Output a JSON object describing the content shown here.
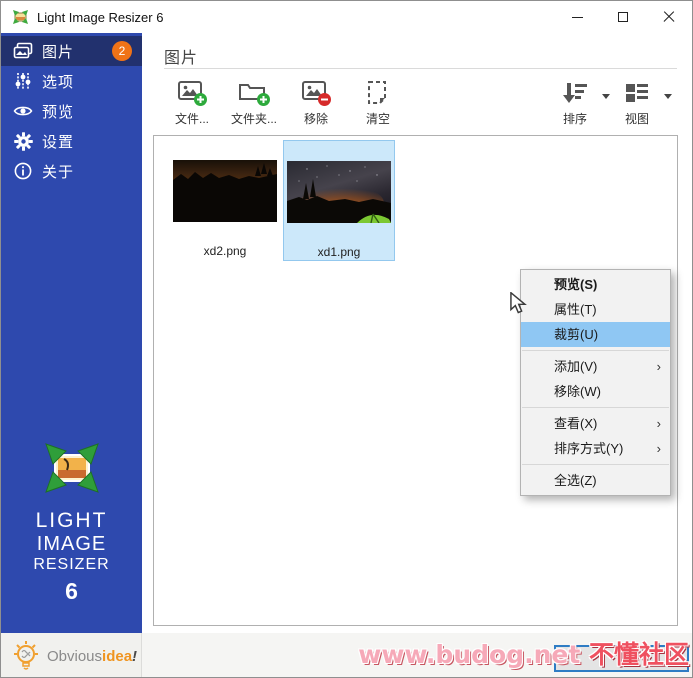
{
  "window": {
    "title": "Light Image Resizer 6"
  },
  "sidebar": {
    "items": [
      {
        "label": "图片",
        "icon": "photos-icon",
        "badge": "2",
        "selected": true
      },
      {
        "label": "选项",
        "icon": "sliders-icon",
        "selected": false
      },
      {
        "label": "预览",
        "icon": "eye-icon",
        "selected": false
      },
      {
        "label": "设置",
        "icon": "gear-icon",
        "selected": false
      },
      {
        "label": "关于",
        "icon": "info-icon",
        "selected": false
      }
    ],
    "logo": {
      "line1": "LIGHT",
      "line2": "IMAGE",
      "line3": "RESIZER",
      "version": "6"
    },
    "brand": {
      "prefix": "Obvious",
      "highlight": "idea",
      "suffix": "!"
    }
  },
  "main": {
    "page_title": "图片",
    "toolbar": {
      "add_files": "文件...",
      "add_folder": "文件夹...",
      "remove": "移除",
      "clear": "清空",
      "sort": "排序",
      "view": "视图"
    },
    "files": [
      {
        "name": "xd2.png",
        "selected": false
      },
      {
        "name": "xd1.png",
        "selected": true
      }
    ],
    "context_menu": {
      "items": [
        {
          "label": "预览(S)",
          "bold": true
        },
        {
          "label": "属性(T)"
        },
        {
          "label": "裁剪(U)",
          "highlighted": true
        },
        {
          "label": "添加(V)",
          "submenu": true
        },
        {
          "label": "移除(W)"
        },
        {
          "label": "查看(X)",
          "submenu": true
        },
        {
          "label": "排序方式(Y)",
          "submenu": true
        },
        {
          "label": "全选(Z)"
        }
      ],
      "submenu_arrow": "›"
    }
  },
  "watermark": {
    "url": "www.budog.net ",
    "community": "不懂社区"
  },
  "colors": {
    "sidebar": "#2e49ae",
    "sidebar_selected": "#22316e",
    "badge": "#f07317",
    "menu_highlight": "#8fc7f3",
    "tile_selected": "#cce8fa",
    "action_button_border": "#2e7cc4"
  }
}
